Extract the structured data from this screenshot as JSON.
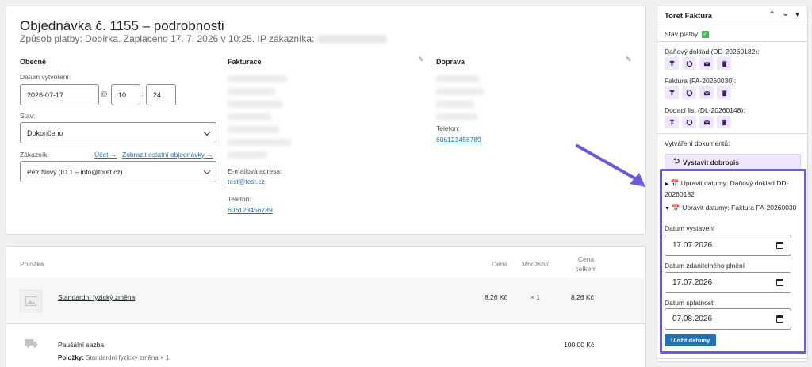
{
  "order": {
    "title": "Objednávka č. 1155 – podrobnosti",
    "subtitle": "Způsob platby: Dobírka. Zaplaceno 17. 7. 2026 v 10:25. IP zákazníka:",
    "general": {
      "heading": "Obecné",
      "date_label": "Datum vytvoření:",
      "date_value": "2026-07-17",
      "at_sign": "@",
      "hour_value": "10",
      "colon": ":",
      "minute_value": "24",
      "status_label": "Stav:",
      "status_value": "Dokončeno",
      "customer_label": "Zákazník:",
      "account_link": "Účet →",
      "other_orders_link": "Zobrazit ostatní objednávky →",
      "customer_value": "Petr Nový (ID 1 – info@toret.cz)"
    },
    "billing": {
      "heading": "Fakturace",
      "email_label": "E-mailová adresa:",
      "email_value": "test@test.cz",
      "phone_label": "Telefon:",
      "phone_value": "606123456789"
    },
    "shipping": {
      "heading": "Doprava",
      "phone_label": "Telefon:",
      "phone_value": "606123456789"
    }
  },
  "items": {
    "headers": {
      "item": "Položka",
      "price": "Cena",
      "qty": "Množství",
      "total": "Cena celkem"
    },
    "product": {
      "name": "Standardní fyzický změna",
      "price": "8.26 Kč",
      "qty": "× 1",
      "total": "8.26 Kč"
    },
    "shipping_line": {
      "name": "Paušální sazba",
      "items_label": "Položky:",
      "items_value": "Standardní fyzický změna × 1",
      "total": "100.00 Kč"
    }
  },
  "sidebar": {
    "title": "Toret Faktura",
    "payment_status_label": "Stav platby:",
    "documents": [
      {
        "label": "Daňový doklad (DD-20260182):"
      },
      {
        "label": "Faktura (FA-20260030):"
      },
      {
        "label": "Dodací list (DL-20260148):"
      }
    ],
    "create_label": "Vytváření dokumentů:",
    "credit_button": "Vystavit dobropis",
    "edit_dates_1": "Upravit datumy: Daňový doklad DD-20260182",
    "edit_dates_2": "Upravit datumy: Faktura FA-20260030",
    "issue_date_label": "Datum vystavení",
    "issue_date_value": "17.07.2026",
    "tax_date_label": "Datum zdanitelného plnění",
    "tax_date_value": "17.07.2026",
    "due_date_label": "Datum splatnosti",
    "due_date_value": "07.08.2026",
    "save_button": "Uložit datumy"
  },
  "colors": {
    "accent": "#2271b1",
    "highlight": "#6a5bd8",
    "icon_bg": "#efe7fb",
    "check": "#46b450"
  }
}
